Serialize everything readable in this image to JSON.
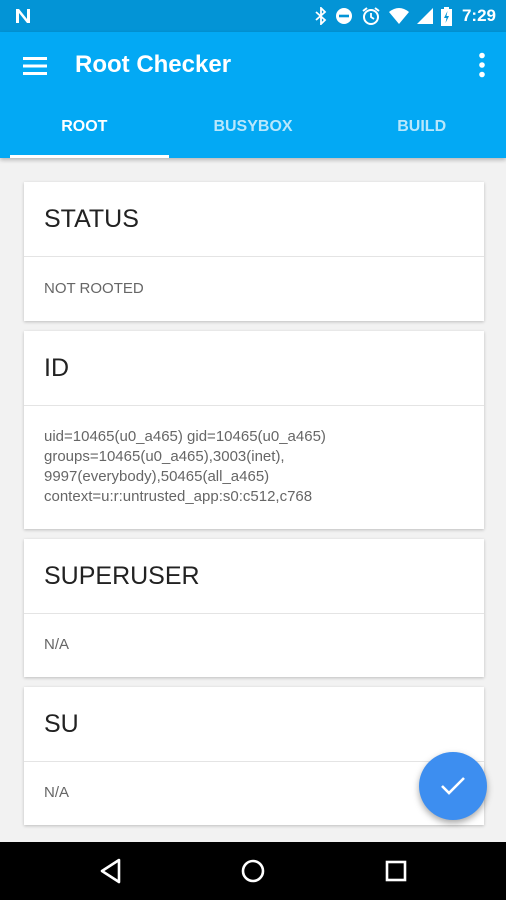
{
  "status_bar": {
    "time": "7:29",
    "icons": [
      "n-icon",
      "bluetooth-icon",
      "do-not-disturb-icon",
      "alarm-icon",
      "wifi-icon",
      "signal-icon",
      "battery-charging-icon"
    ]
  },
  "app_bar": {
    "title": "Root Checker",
    "menu_icon": "menu-icon",
    "overflow_icon": "more-vertical-icon"
  },
  "tabs": [
    {
      "label": "ROOT",
      "active": true
    },
    {
      "label": "BUSYBOX",
      "active": false
    },
    {
      "label": "BUILD",
      "active": false
    }
  ],
  "cards": [
    {
      "title": "STATUS",
      "lines": [
        "NOT ROOTED"
      ]
    },
    {
      "title": "ID",
      "lines": [
        "uid=10465(u0_a465) gid=10465(u0_a465)",
        "groups=10465(u0_a465),3003(inet),",
        "9997(everybody),50465(all_a465)",
        "context=u:r:untrusted_app:s0:c512,c768"
      ]
    },
    {
      "title": "SUPERUSER",
      "lines": [
        "N/A"
      ]
    },
    {
      "title": "SU",
      "lines": [
        "N/A"
      ]
    }
  ],
  "fab": {
    "icon": "check-icon"
  },
  "nav_bar": {
    "icons": [
      "back-icon",
      "home-icon",
      "recents-icon"
    ]
  },
  "colors": {
    "status_bar": "#0394d6",
    "app_bar": "#03a9f4",
    "fab": "#3d8ef0",
    "background": "#f2f2f2"
  }
}
